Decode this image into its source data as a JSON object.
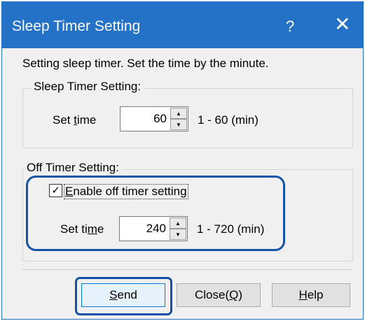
{
  "window": {
    "title": "Sleep Timer Setting",
    "help_glyph": "?",
    "close_glyph": "✕"
  },
  "description": "Setting sleep timer. Set the time by the minute.",
  "sleep_group": {
    "label": "Sleep Timer Setting:",
    "set_time_prefix": "Set ",
    "set_time_accel": "t",
    "set_time_suffix": "ime",
    "value": "60",
    "range": "1 - 60 (min)"
  },
  "off_group": {
    "label": "Off Timer Setting:",
    "checkbox_checked": true,
    "checkbox_glyph": "✓",
    "checkbox_accel": "E",
    "checkbox_rest": "nable off timer setting",
    "set_time_prefix": "Set ti",
    "set_time_accel": "m",
    "set_time_suffix": "e",
    "value": "240",
    "range": "1 - 720 (min)"
  },
  "buttons": {
    "send_accel": "S",
    "send_rest": "end",
    "close_prefix": "Close(",
    "close_accel": "Q",
    "close_suffix": ")",
    "help_accel": "H",
    "help_rest": "elp"
  },
  "spin_up_glyph": "▲",
  "spin_down_glyph": "▼",
  "highlight_color": "#1452a8",
  "titlebar_color": "#2472c8"
}
